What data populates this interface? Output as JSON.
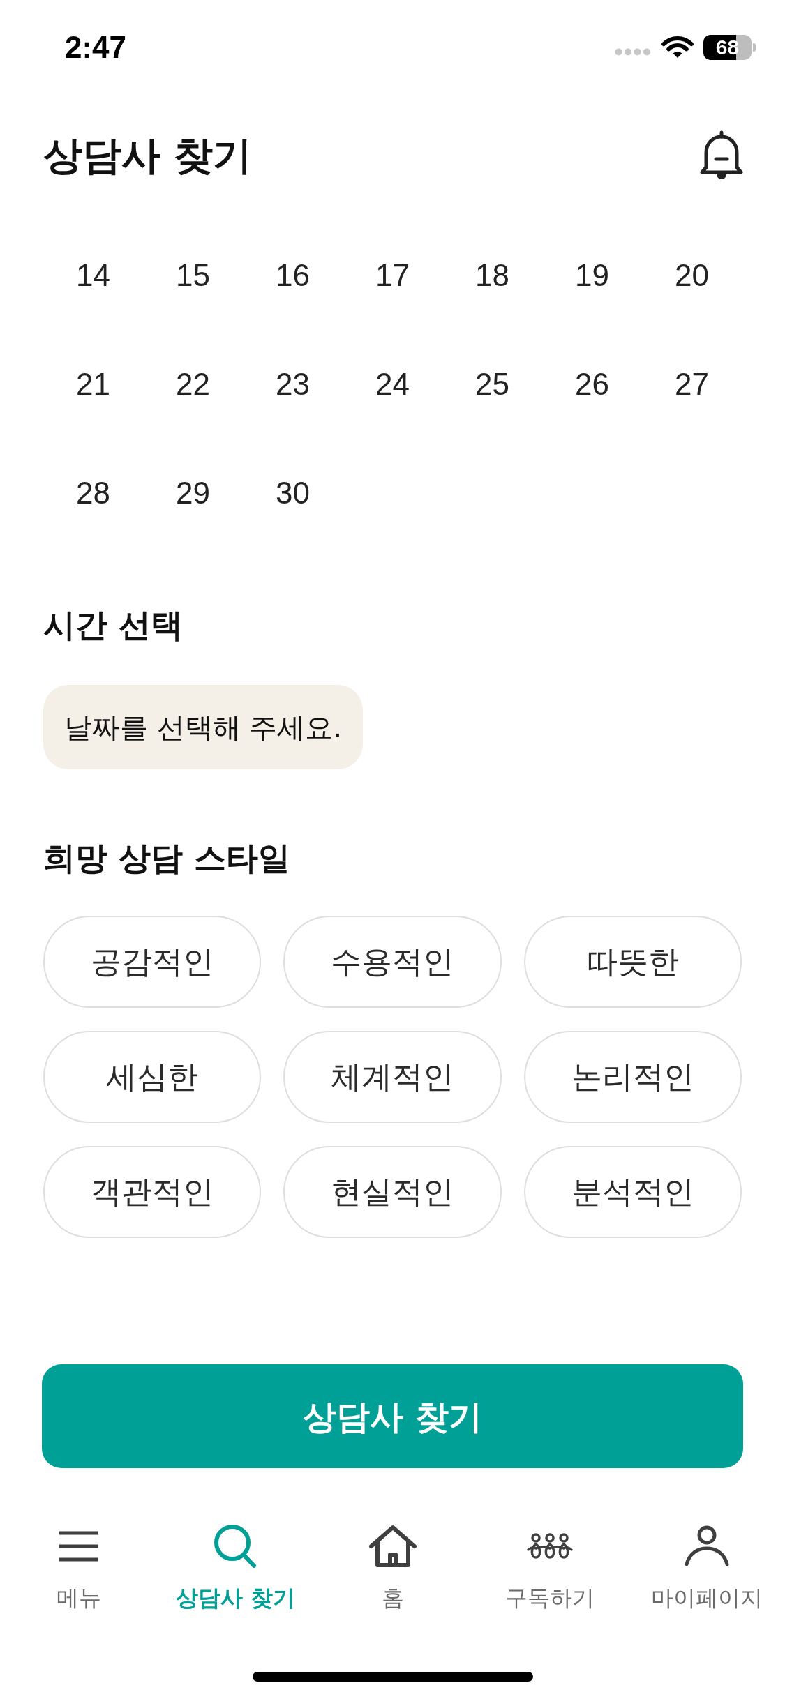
{
  "status_bar": {
    "time": "2:47",
    "battery": "68"
  },
  "header": {
    "title": "상담사 찾기"
  },
  "calendar": {
    "days": [
      {
        "label": "14",
        "selected": false
      },
      {
        "label": "15",
        "selected": false
      },
      {
        "label": "16",
        "selected": false
      },
      {
        "label": "17",
        "selected": false
      },
      {
        "label": "18",
        "selected": false
      },
      {
        "label": "19",
        "selected": false
      },
      {
        "label": "20",
        "selected": false
      },
      {
        "label": "21",
        "selected": false
      },
      {
        "label": "22",
        "selected": false
      },
      {
        "label": "23",
        "selected": false
      },
      {
        "label": "24",
        "selected": false
      },
      {
        "label": "25",
        "selected": false
      },
      {
        "label": "26",
        "selected": false
      },
      {
        "label": "27",
        "selected": false
      },
      {
        "label": "28",
        "selected": false
      },
      {
        "label": "29",
        "selected": false
      },
      {
        "label": "30",
        "selected": false
      }
    ]
  },
  "time_select": {
    "title": "시간 선택",
    "message": "날짜를 선택해 주세요."
  },
  "counseling_style": {
    "title": "희망 상담 스타일",
    "options": [
      {
        "label": "공감적인",
        "selected": false
      },
      {
        "label": "수용적인",
        "selected": false
      },
      {
        "label": "따뜻한",
        "selected": false
      },
      {
        "label": "세심한",
        "selected": false
      },
      {
        "label": "체계적인",
        "selected": false
      },
      {
        "label": "논리적인",
        "selected": false
      },
      {
        "label": "객관적인",
        "selected": false
      },
      {
        "label": "현실적인",
        "selected": false
      },
      {
        "label": "분석적인",
        "selected": false
      }
    ]
  },
  "search_button": {
    "label": "상담사 찾기"
  },
  "tab_bar": {
    "tabs": [
      {
        "kind": "menu",
        "label": "메뉴",
        "selected": false
      },
      {
        "kind": "search",
        "label": "상담사 찾기",
        "selected": true
      },
      {
        "kind": "home",
        "label": "홈",
        "selected": false
      },
      {
        "kind": "subscribe",
        "label": "구독하기",
        "selected": false
      },
      {
        "kind": "profile",
        "label": "마이페이지",
        "selected": false
      }
    ]
  }
}
